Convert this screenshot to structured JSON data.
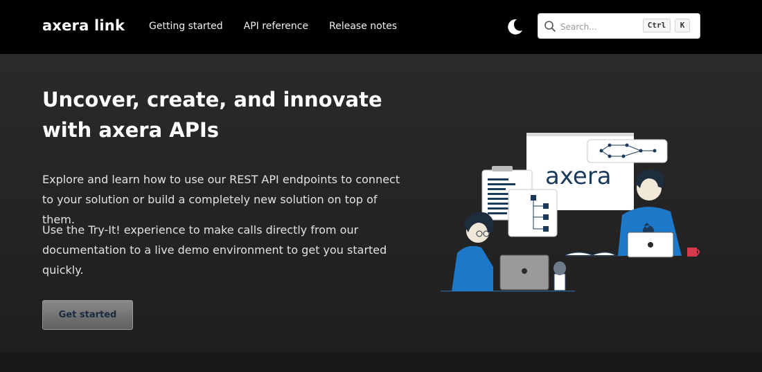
{
  "header": {
    "brand": "axera link",
    "nav": [
      "Getting started",
      "API reference",
      "Release notes"
    ],
    "theme_icon": "moon-icon",
    "search": {
      "placeholder": "Search...",
      "shortcut": [
        "Ctrl",
        "K"
      ]
    }
  },
  "hero": {
    "title": "Uncover, create, and innovate with axera APIs",
    "paragraph1": "Explore and learn how to use our REST API endpoints to connect to your solution or build a completely new solution on top of them.",
    "paragraph2": "Use the Try-It! experience to make calls directly from our documentation to a live demo environment to get you started quickly.",
    "cta_label": "Get started",
    "illustration_text": "axera"
  },
  "colors": {
    "header_bg": "#000000",
    "hero_bg": "#242424",
    "accent_blue": "#1e78c8",
    "navy": "#1a3a5c"
  }
}
